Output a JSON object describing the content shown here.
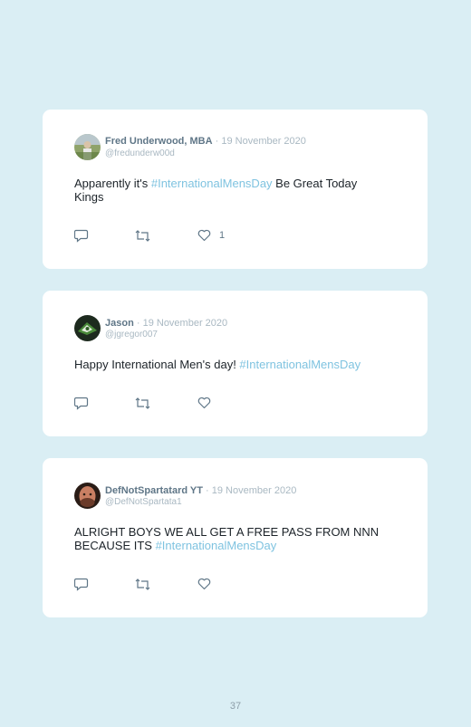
{
  "tweets": [
    {
      "name": "Fred Underwood, MBA",
      "date": "· 19 November 2020",
      "handle": "@fredunderw00d",
      "text_before": "Apparently it's ",
      "hashtag": "#InternationalMensDay",
      "text_after": " Be Great Today Kings",
      "likes": "1",
      "avatar_icon": "avatar-photo-outdoor"
    },
    {
      "name": "Jason",
      "date": "· 19 November 2020",
      "handle": "@jgregor007",
      "text_before": "Happy International Men's day! ",
      "hashtag": "#InternationalMensDay",
      "text_after": "",
      "likes": "",
      "avatar_icon": "avatar-photo-green"
    },
    {
      "name": "DefNotSpartatard YT",
      "date": "· 19 November 2020",
      "handle": "@DefNotSpartata1",
      "text_before": "ALRIGHT BOYS WE ALL GET A FREE PASS FROM NNN BECAUSE ITS ",
      "hashtag": "#InternationalMensDay",
      "text_after": "",
      "likes": "",
      "avatar_icon": "avatar-photo-face"
    }
  ],
  "page_number": "37",
  "colors": {
    "background": "#daeef4",
    "card": "#ffffff",
    "hashtag": "#7fc3e0",
    "name": "#5f7687",
    "muted": "#a9b8c2"
  }
}
